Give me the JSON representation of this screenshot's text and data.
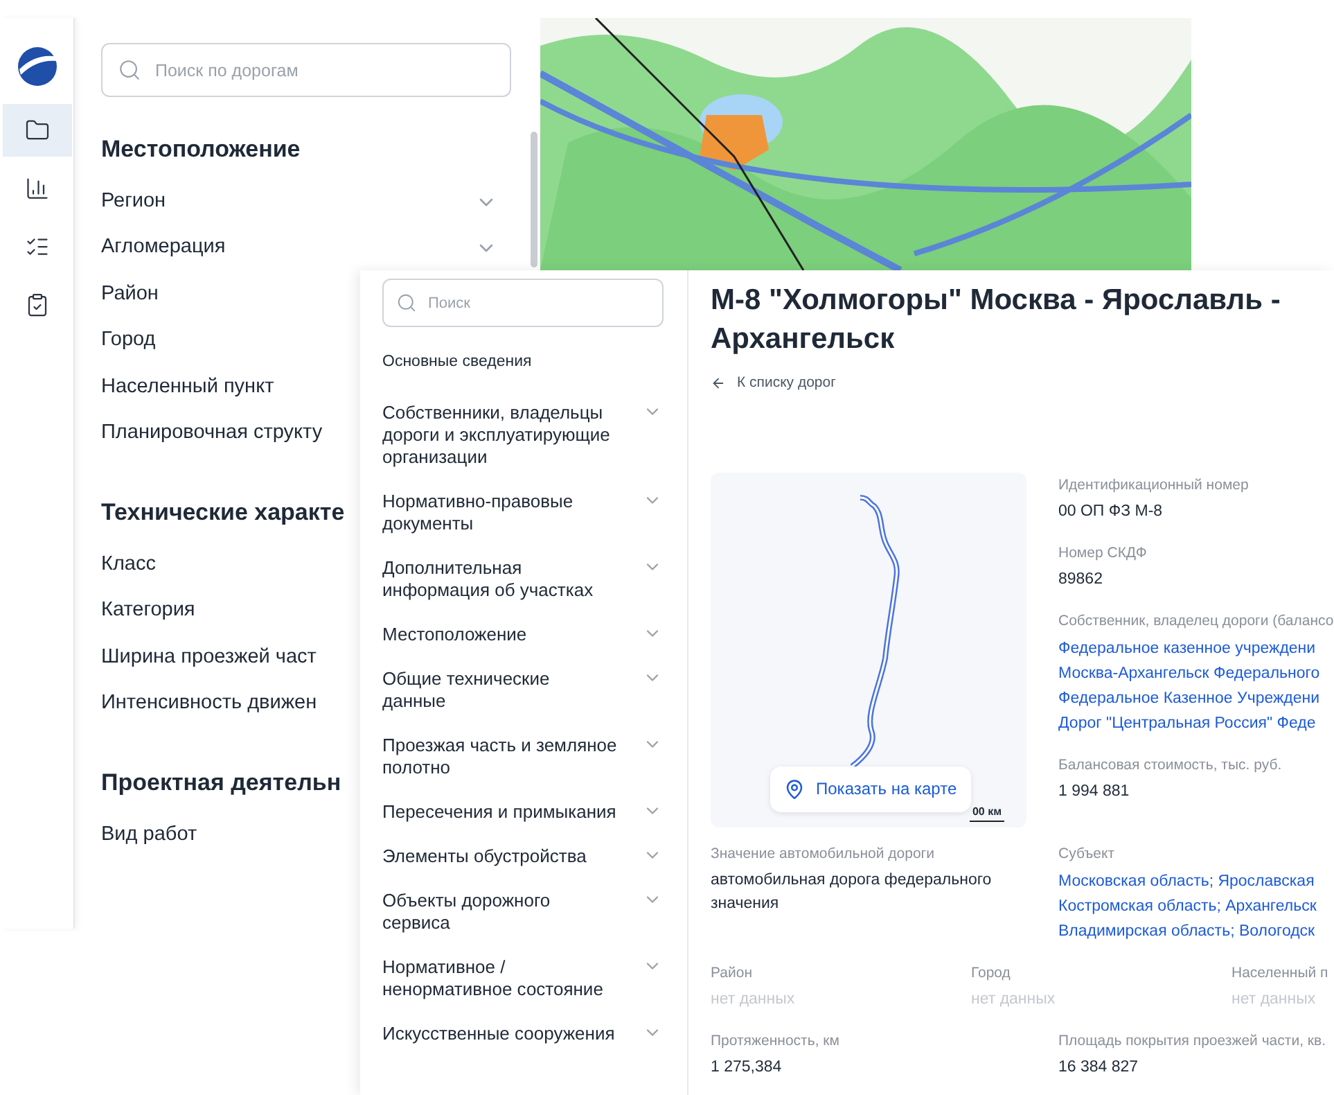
{
  "nav_icons": [
    {
      "selected": true
    },
    {
      "selected": false
    },
    {
      "selected": false
    },
    {
      "selected": false
    }
  ],
  "filter_panel": {
    "search": {
      "placeholder": "Поиск по дорогам"
    },
    "sections": [
      {
        "title": "Местоположение",
        "items": [
          {
            "label": "Регион",
            "dropdown": true
          },
          {
            "label": "Агломерация",
            "dropdown": true
          },
          {
            "label": "Район",
            "dropdown": false
          },
          {
            "label": "Город",
            "dropdown": false
          },
          {
            "label": "Населенный пункт",
            "dropdown": false
          },
          {
            "label": "Планировочная структу",
            "dropdown": false
          }
        ]
      },
      {
        "title": "Технические характе",
        "items": [
          {
            "label": "Класс",
            "dropdown": false
          },
          {
            "label": "Категория",
            "dropdown": false
          },
          {
            "label": "Ширина проезжей част",
            "dropdown": false
          },
          {
            "label": "Интенсивность движен",
            "dropdown": false
          }
        ]
      },
      {
        "title": "Проектная деятельн",
        "items": [
          {
            "label": "Вид работ",
            "dropdown": false
          }
        ]
      }
    ]
  },
  "road_card": {
    "search": {
      "placeholder": "Поиск"
    },
    "sections": [
      {
        "label": "Основные сведения",
        "kind": "link"
      },
      {
        "label": "Собственники, владельцы дороги и эксплуатирующие организации",
        "kind": "group"
      },
      {
        "label": "Нормативно-правовые документы",
        "kind": "group"
      },
      {
        "label": "Дополнительная информация об участках",
        "kind": "group"
      },
      {
        "label": "Местоположение",
        "kind": "group"
      },
      {
        "label": "Общие технические данные",
        "kind": "group"
      },
      {
        "label": "Проезжая часть и земляное полотно",
        "kind": "group"
      },
      {
        "label": "Пересечения и примыкания",
        "kind": "group"
      },
      {
        "label": "Элементы обустройства",
        "kind": "group"
      },
      {
        "label": "Объекты дорожного сервиса",
        "kind": "group"
      },
      {
        "label": "Нормативное / ненормативное состояние",
        "kind": "group"
      },
      {
        "label": "Искусственные сооружения",
        "kind": "group"
      }
    ],
    "title_lines": [
      "М-8 \"Холмогоры\" Москва - Ярославль -",
      "Архангельск"
    ],
    "back_link": "К списку дорог",
    "map_preview": {
      "button": "Показать на карте",
      "scale": "00 км"
    },
    "side_fields": [
      {
        "label": "Идентификационный номер",
        "kind": "text",
        "values": [
          "00 ОП ФЗ М-8"
        ]
      },
      {
        "label": "Номер СКДФ",
        "kind": "text",
        "values": [
          "89862"
        ]
      },
      {
        "label": "Собственник, владелец дороги (балансо",
        "kind": "link",
        "values": [
          "Федеральное казенное учреждени",
          "Москва-Архангельск Федерального",
          "Федеральное Казенное Учреждени",
          "Дорог \"Центральная Россия\" Феде"
        ]
      },
      {
        "label": "Балансовая стоимость, тыс. руб.",
        "kind": "text",
        "values": [
          "1 994 881"
        ]
      }
    ],
    "field_rows": [
      [
        {
          "label": "Значение автомобильной дороги",
          "kind": "text",
          "values": [
            "автомобильная дорога федерального значения"
          ]
        },
        {
          "label": "Субъект",
          "kind": "link",
          "values": [
            "Московская область; Ярославская",
            "Костромская область; Архангельск",
            "Владимирская область; Вологодск"
          ]
        }
      ],
      [
        {
          "label": "Район",
          "kind": "missing",
          "values": [
            "нет данных"
          ]
        },
        {
          "label": "Город",
          "kind": "missing",
          "values": [
            "нет данных"
          ]
        },
        {
          "label": "Населенный п",
          "kind": "missing",
          "values": [
            "нет данных"
          ]
        }
      ],
      [
        {
          "label": "Протяженность, км",
          "kind": "text",
          "values": [
            "1 275,384"
          ]
        },
        {
          "label": "Площадь покрытия проезжей части, кв.",
          "kind": "text",
          "values": [
            "16 384 827"
          ]
        }
      ]
    ]
  }
}
